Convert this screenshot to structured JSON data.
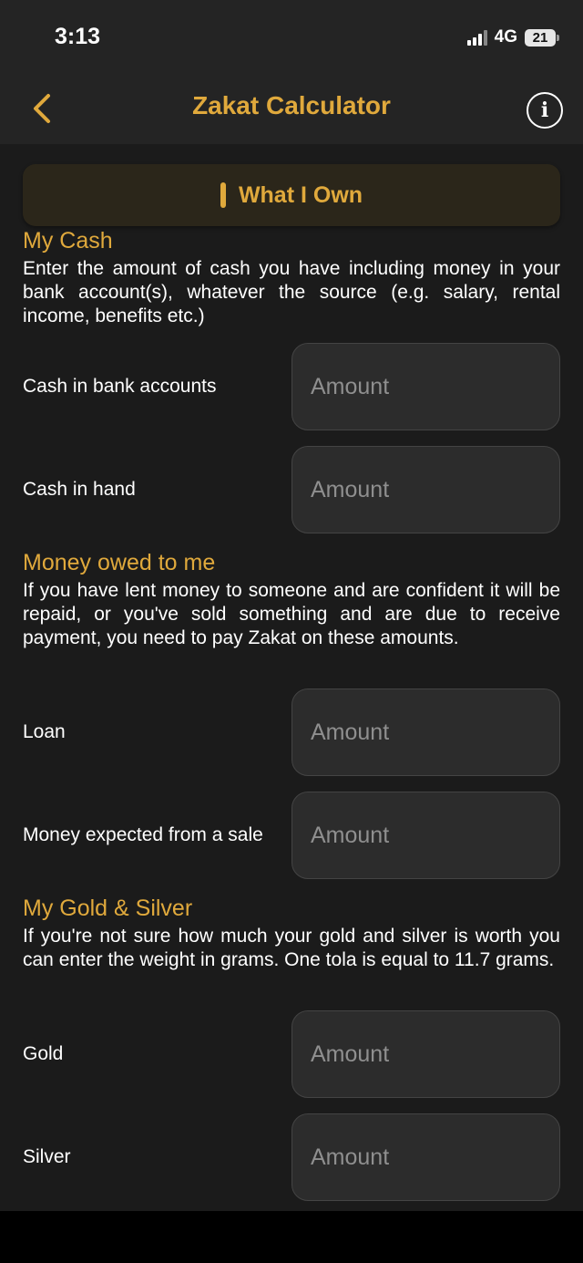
{
  "status": {
    "time": "3:13",
    "network": "4G",
    "battery": "21"
  },
  "header": {
    "title": "Zakat Calculator",
    "back_icon": "chevron-left-icon",
    "info_icon": "info-icon"
  },
  "colors": {
    "accent": "#e0a93c",
    "background": "#1b1b1b",
    "header": "#242424",
    "input": "#2c2c2c"
  },
  "section": {
    "label": "What I Own"
  },
  "cash": {
    "heading": "My Cash",
    "description": "Enter the amount of cash you have including money in your bank account(s), whatever the source (e.g. salary, rental income, benefits etc.)",
    "fields": [
      {
        "label": "Cash in bank accounts",
        "placeholder": "Amount"
      },
      {
        "label": "Cash in hand",
        "placeholder": "Amount"
      }
    ]
  },
  "owed": {
    "heading": "Money owed to me",
    "description": "If you have lent money to someone and are confident it will be repaid, or you've sold something and are due to receive payment, you need to pay Zakat on these amounts.",
    "fields": [
      {
        "label": "Loan",
        "placeholder": "Amount"
      },
      {
        "label": "Money expected from a sale",
        "placeholder": "Amount"
      }
    ]
  },
  "gold": {
    "heading": "My Gold & Silver",
    "description": "If you're not sure how much your gold and silver is worth you can enter the weight in grams. One tola is equal to 11.7 grams.",
    "fields": [
      {
        "label": "Gold",
        "placeholder": "Amount"
      },
      {
        "label": "Silver",
        "placeholder": "Amount"
      }
    ]
  }
}
